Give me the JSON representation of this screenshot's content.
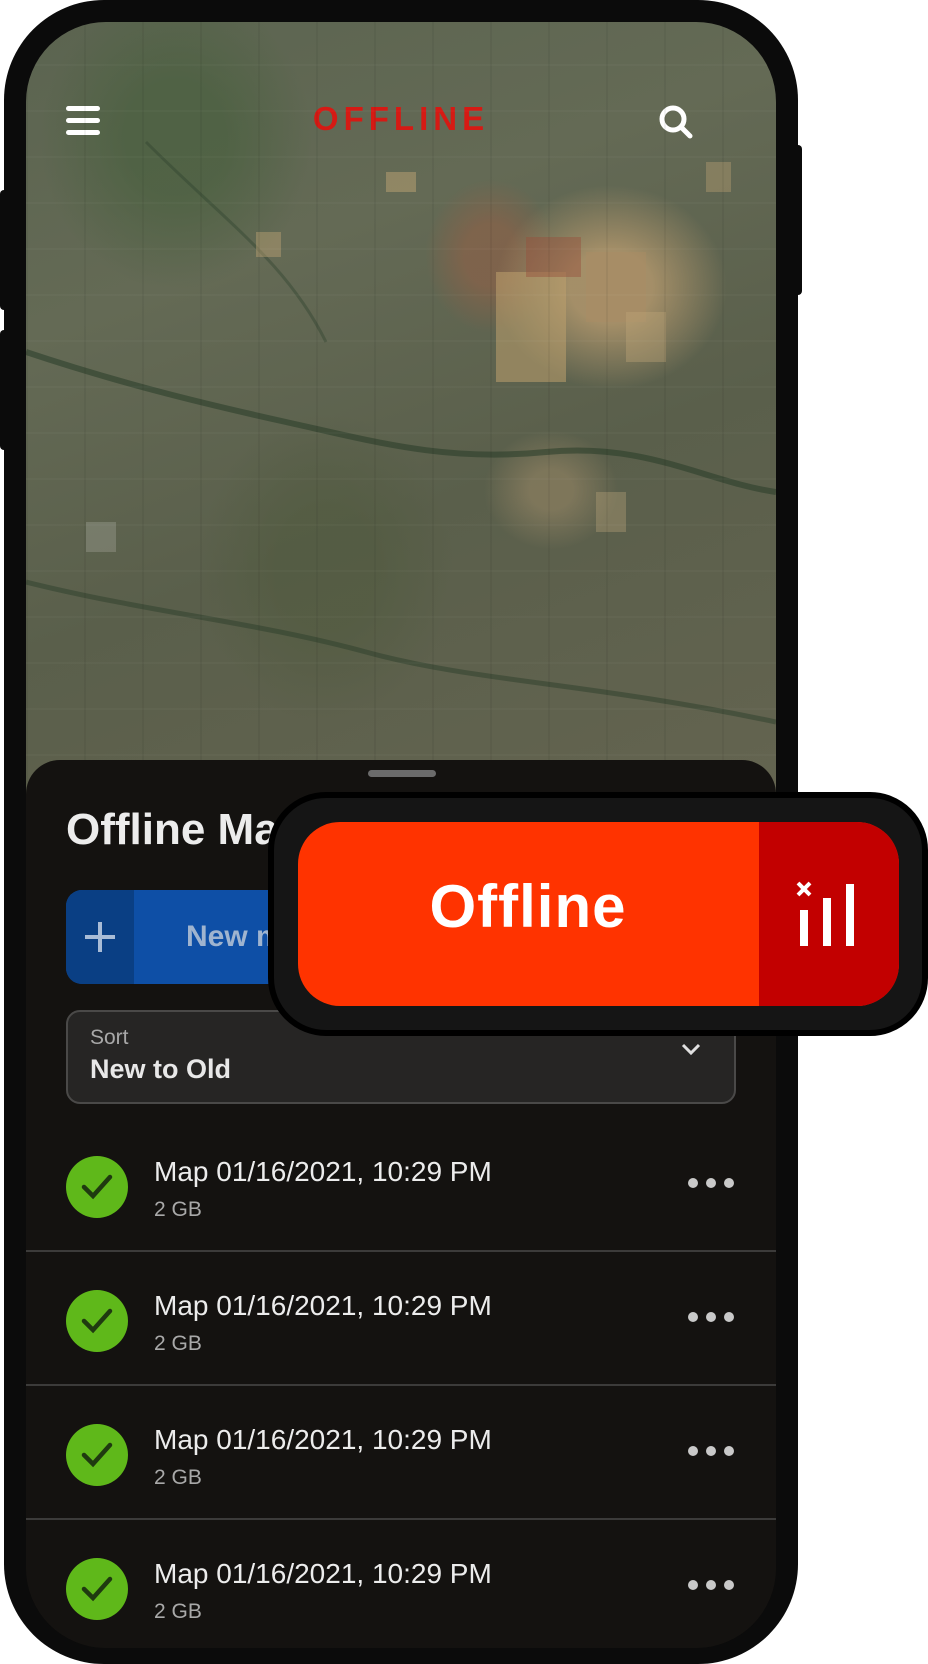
{
  "app": {
    "brand": "OFFLINE"
  },
  "sheet": {
    "title": "Offline Maps",
    "new_button_label": "New map",
    "sort": {
      "label": "Sort",
      "value": "New to Old"
    }
  },
  "maps": [
    {
      "title": "Map 01/16/2021, 10:29 PM",
      "size": "2 GB",
      "status": "downloaded"
    },
    {
      "title": "Map 01/16/2021, 10:29 PM",
      "size": "2 GB",
      "status": "downloaded"
    },
    {
      "title": "Map 01/16/2021, 10:29 PM",
      "size": "2 GB",
      "status": "downloaded"
    },
    {
      "title": "Map 01/16/2021, 10:29 PM",
      "size": "2 GB",
      "status": "downloaded"
    }
  ],
  "badge": {
    "label": "Offline",
    "icon": "signal-off-icon"
  },
  "colors": {
    "brand_red": "#d61a14",
    "badge_orange": "#ff3300",
    "badge_dark_red": "#c20000",
    "button_blue": "#0e4fa6",
    "check_green": "#5fb81a"
  }
}
